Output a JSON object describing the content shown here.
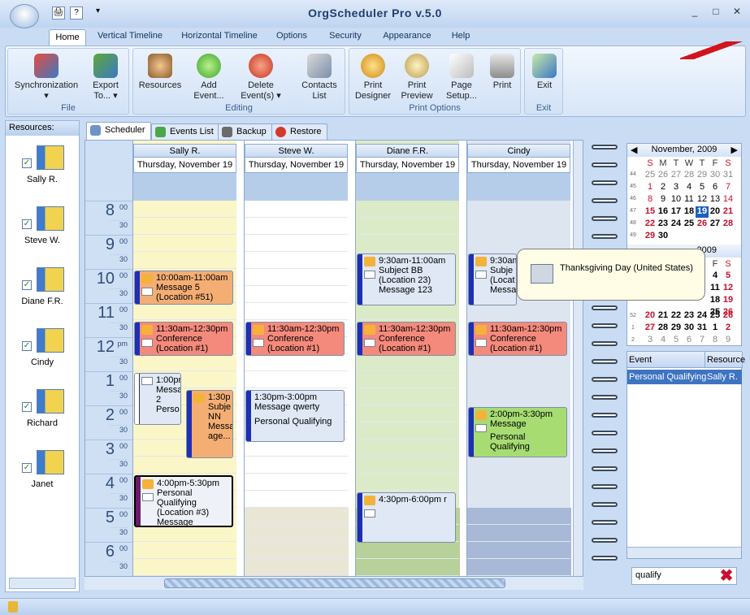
{
  "window": {
    "title": "OrgScheduler Pro v.5.0",
    "min": "_",
    "max": "□",
    "close": "✕"
  },
  "quick_access": {
    "print": "🖨",
    "help": "?",
    "customize": "▾"
  },
  "tabs": [
    "Home",
    "Vertical Timeline",
    "Horizontal Timeline",
    "Options",
    "Security",
    "Appearance",
    "Help"
  ],
  "ribbon": {
    "file": {
      "caption": "File",
      "sync_line1": "Synchronization",
      "sync_line2": "▾",
      "export_line1": "Export",
      "export_line2": "To... ▾"
    },
    "editing": {
      "caption": "Editing",
      "resources": "Resources",
      "add_line1": "Add",
      "add_line2": "Event...",
      "del_line1": "Delete",
      "del_line2": "Event(s) ▾",
      "contacts_line1": "Contacts",
      "contacts_line2": "List"
    },
    "print": {
      "caption": "Print Options",
      "designer_line1": "Print",
      "designer_line2": "Designer",
      "preview_line1": "Print",
      "preview_line2": "Preview",
      "setup_line1": "Page",
      "setup_line2": "Setup...",
      "print": "Print"
    },
    "exit": {
      "caption": "Exit",
      "exit": "Exit"
    }
  },
  "resources": {
    "header": "Resources:",
    "items": [
      "Sally R.",
      "Steve W.",
      "Diane F.R.",
      "Cindy",
      "Richard",
      "Janet"
    ]
  },
  "scheduler_tabs": [
    "Scheduler",
    "Events List",
    "Backup",
    "Restore"
  ],
  "columns": [
    {
      "name": "Sally R.",
      "date": "Thursday, November 19"
    },
    {
      "name": "Steve W.",
      "date": "Thursday, November 19"
    },
    {
      "name": "Diane F.R.",
      "date": "Thursday, November 19"
    },
    {
      "name": "Cindy",
      "date": "Thursday, November 19"
    }
  ],
  "hours": [
    {
      "h": "8",
      "s": "00",
      "m": "30"
    },
    {
      "h": "9",
      "s": "00",
      "m": "30"
    },
    {
      "h": "10",
      "s": "00",
      "m": "30"
    },
    {
      "h": "11",
      "s": "00",
      "m": "30"
    },
    {
      "h": "12",
      "s": "pm",
      "m": "30"
    },
    {
      "h": "1",
      "s": "00",
      "m": "30"
    },
    {
      "h": "2",
      "s": "00",
      "m": "30"
    },
    {
      "h": "3",
      "s": "00",
      "m": "30"
    },
    {
      "h": "4",
      "s": "00",
      "m": "30"
    },
    {
      "h": "5",
      "s": "00",
      "m": "30"
    },
    {
      "h": "6",
      "s": "00",
      "m": "30"
    }
  ],
  "events": {
    "e1": {
      "l1": "10:00am-11:00am",
      "l2": "Message 5",
      "l3": "(Location #51)"
    },
    "e2": {
      "l1": "11:30am-12:30pm",
      "l2": "Conference",
      "l3": "(Location #1)"
    },
    "e3": {
      "l1": "1:00pm",
      "l2": "Messa",
      "l3": "2",
      "l4": "Perso"
    },
    "e4": {
      "l1": "1:30p",
      "l2": "Subje",
      "l3": "NN",
      "l4": "Messa",
      "l5": "age..."
    },
    "e5": {
      "l1": "4:00pm-5:30pm",
      "l2": "Personal Qualifying",
      "l3": "(Location #3)",
      "l4": "Message"
    },
    "e6": {
      "l1": "11:30am-12:30pm",
      "l2": "Conference",
      "l3": "(Location #1)"
    },
    "e7": {
      "l1": "1:30pm-3:00pm",
      "l2": "Message qwerty",
      "l3": "Personal Qualifying"
    },
    "e8": {
      "l1": "9:30am-11:00am",
      "l2": "Subject BB",
      "l3": "(Location 23)",
      "l4": "Message 123"
    },
    "e9": {
      "l1": "11:30am-12:30pm",
      "l2": "Conference",
      "l3": "(Location #1)"
    },
    "e10": {
      "l1": "4:30pm-6:00pm r"
    },
    "e11": {
      "l1": "9:30am",
      "l2": "Subje",
      "l3": "(Locat",
      "l4": "Messa"
    },
    "e12": {
      "l1": "11:30am-12:30pm",
      "l2": "Conference",
      "l3": "(Location #1)"
    },
    "e13": {
      "l1": "2:00pm-3:30pm",
      "l2": "Message",
      "l3": "Personal",
      "l4": "Qualifying"
    }
  },
  "calendar": {
    "month": "November, 2009",
    "month2": "2009",
    "prev": "◀",
    "next": "▶",
    "dow": [
      "S",
      "M",
      "T",
      "W",
      "T",
      "F",
      "S"
    ],
    "weeks": [
      "44",
      "45",
      "46",
      "47",
      "48",
      "49"
    ],
    "days": [
      [
        "25",
        "26",
        "27",
        "28",
        "29",
        "30",
        "31"
      ],
      [
        "1",
        "2",
        "3",
        "4",
        "5",
        "6",
        "7"
      ],
      [
        "8",
        "9",
        "10",
        "11",
        "12",
        "13",
        "14"
      ],
      [
        "15",
        "16",
        "17",
        "18",
        "19",
        "20",
        "21"
      ],
      [
        "22",
        "23",
        "24",
        "25",
        "26",
        "27",
        "28"
      ],
      [
        "29",
        "30",
        "",
        "",
        "",
        "",
        ""
      ]
    ],
    "dow2": [
      "F",
      "S"
    ],
    "days2": [
      [
        "4",
        "5"
      ],
      [
        "11",
        "12"
      ],
      [
        "18",
        "19"
      ],
      [
        "25",
        "26"
      ],
      [
        "1",
        "2"
      ],
      [
        "8",
        "9"
      ]
    ],
    "weeks2": [
      "52",
      "1",
      "2"
    ],
    "row2": [
      [
        "20",
        "21",
        "22",
        "23",
        "24",
        "25",
        "26"
      ],
      [
        "27",
        "28",
        "29",
        "30",
        "31",
        "1",
        "2"
      ],
      [
        "3",
        "4",
        "5",
        "6",
        "7",
        "8",
        "9"
      ]
    ],
    "tooltip": "Thanksgiving Day (United States)"
  },
  "event_list": {
    "col1": "Event",
    "col2": "Resource",
    "row": [
      "Personal Qualifying",
      "Sally R."
    ]
  },
  "search": {
    "value": "qualify"
  },
  "colors": {
    "orange_evt": "#f4ae74",
    "red_evt": "#f48a7c",
    "green_evt": "#a7dc73",
    "blue_evt": "#dfe8f4",
    "accent_bar": "#1c2fb5"
  }
}
